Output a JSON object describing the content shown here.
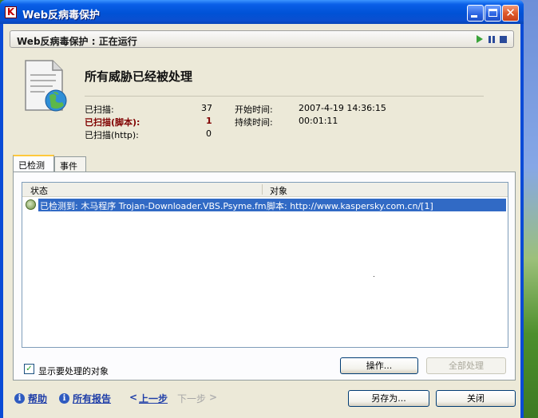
{
  "window": {
    "title": "Web反病毒保护"
  },
  "status": {
    "text": "Web反病毒保护 : 正在运行"
  },
  "summary": {
    "headline": "所有威胁已经被处理",
    "scanned_label": "已扫描:",
    "scanned_value": "37",
    "scanned_script_label": "已扫描(脚本):",
    "scanned_script_value": "1",
    "scanned_http_label": "已扫描(http):",
    "scanned_http_value": "0",
    "start_time_label": "开始时间:",
    "start_time_value": "2007-4-19 14:36:15",
    "duration_label": "持续时间:",
    "duration_value": "00:01:11"
  },
  "tabs": [
    {
      "label": "已检测"
    },
    {
      "label": "事件"
    }
  ],
  "table": {
    "columns": [
      {
        "label": "状态"
      },
      {
        "label": "对象"
      }
    ],
    "rows": [
      {
        "status": "已检测到: 木马程序 Trojan-Downloader.VBS.Psyme.fm",
        "object": "脚本: http://www.kaspersky.com.cn/[1]"
      }
    ]
  },
  "options": {
    "show_label": "显示要处理的对象"
  },
  "buttons": {
    "action": "操作...",
    "process_all": "全部处理",
    "save_as": "另存为...",
    "close": "关闭"
  },
  "footer": {
    "help": "帮助",
    "all_reports": "所有报告",
    "back": "上一步",
    "next": "下一步"
  }
}
